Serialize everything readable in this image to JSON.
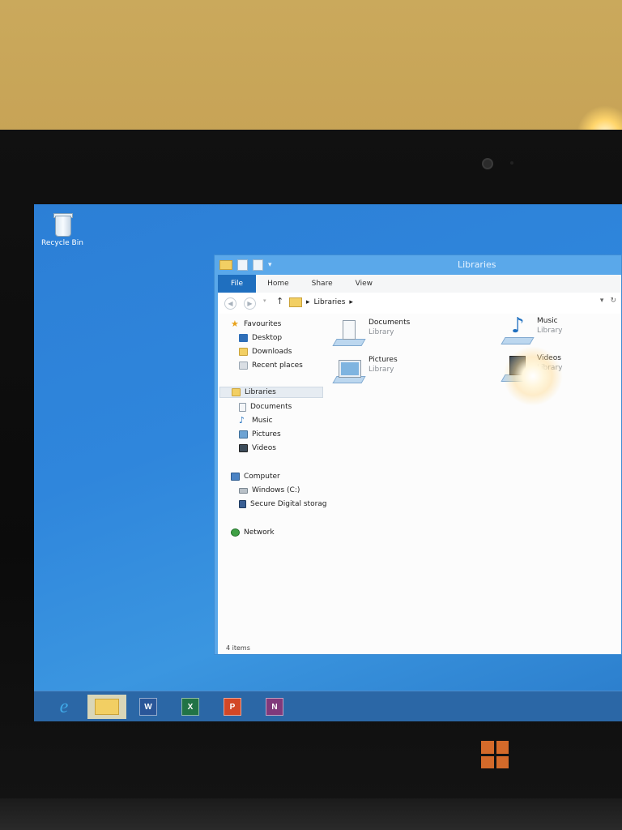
{
  "desktop": {
    "recycle_bin_label": "Recycle Bin"
  },
  "window": {
    "title": "Libraries",
    "ribbon_tabs": [
      "File",
      "Home",
      "Share",
      "View"
    ],
    "address": {
      "crumb": "Libraries",
      "separator": "▸"
    },
    "nav": {
      "favourites": "Favourites",
      "desktop": "Desktop",
      "downloads": "Downloads",
      "recent": "Recent places",
      "libraries": "Libraries",
      "documents": "Documents",
      "music": "Music",
      "pictures": "Pictures",
      "videos": "Videos",
      "computer": "Computer",
      "windows_c": "Windows (C:)",
      "sd": "Secure Digital storag",
      "network": "Network"
    },
    "items": [
      {
        "name": "Documents",
        "type": "Library"
      },
      {
        "name": "Pictures",
        "type": "Library"
      },
      {
        "name": "Music",
        "type": "Library"
      },
      {
        "name": "Videos",
        "type": "Library"
      }
    ],
    "status": "4 items"
  },
  "taskbar": {
    "ie_glyph": "e",
    "word_glyph": "W",
    "excel_glyph": "X",
    "powerpoint_glyph": "P",
    "onenote_glyph": "N"
  },
  "colors": {
    "desktop": "#2f86dc",
    "taskbar": "#2b67a6",
    "file_tab": "#1f6fbf"
  }
}
